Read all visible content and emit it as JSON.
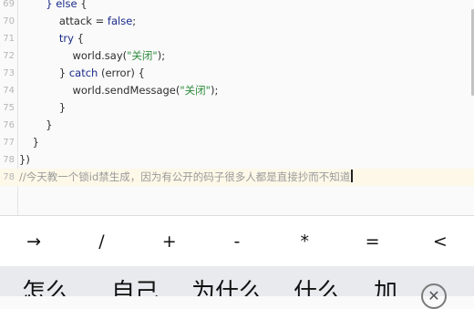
{
  "editor": {
    "lines": [
      {
        "num": "69",
        "parts": [
          [
            "",
            "        "
          ],
          [
            "kw",
            "}"
          ],
          [
            "",
            " "
          ],
          [
            "kw",
            "else"
          ],
          [
            "",
            " {"
          ]
        ]
      },
      {
        "num": "70",
        "parts": [
          [
            "",
            "            attack = "
          ],
          [
            "kw",
            "false"
          ],
          [
            "",
            ";"
          ]
        ]
      },
      {
        "num": "71",
        "parts": [
          [
            "",
            "            "
          ],
          [
            "kw",
            "try"
          ],
          [
            "",
            " {"
          ]
        ]
      },
      {
        "num": "72",
        "parts": [
          [
            "",
            "                world.say("
          ],
          [
            "str",
            "\"关闭\""
          ],
          [
            "",
            ");"
          ]
        ]
      },
      {
        "num": "73",
        "parts": [
          [
            "",
            "            } "
          ],
          [
            "kw",
            "catch"
          ],
          [
            "",
            " (error) {"
          ]
        ]
      },
      {
        "num": "74",
        "parts": [
          [
            "",
            "                world.sendMessage("
          ],
          [
            "str",
            "\"关闭\""
          ],
          [
            "",
            ");"
          ]
        ]
      },
      {
        "num": "75",
        "parts": [
          [
            "",
            "            }"
          ]
        ]
      },
      {
        "num": "76",
        "parts": [
          [
            "",
            "        }"
          ]
        ]
      },
      {
        "num": "77",
        "parts": [
          [
            "",
            "    }"
          ]
        ]
      },
      {
        "num": "78",
        "parts": [
          [
            "",
            "})"
          ]
        ]
      },
      {
        "num": "78",
        "parts": [
          [
            "cmt",
            "//今天教一个锁id禁生成，因为有公开的码子很多人都是直接抄而不知道"
          ]
        ],
        "active": true
      }
    ]
  },
  "symbols": [
    "→",
    "/",
    "+",
    "-",
    "*",
    "=",
    "<"
  ],
  "candidates": [
    "怎么",
    "自己",
    "为什么",
    "什么",
    "加"
  ],
  "close_icon": "close-icon",
  "colors": {
    "keyword": "#1a2b8a",
    "string": "#2a8a3a",
    "comment": "#9a9a9a",
    "active_line": "#fdf8e8"
  }
}
